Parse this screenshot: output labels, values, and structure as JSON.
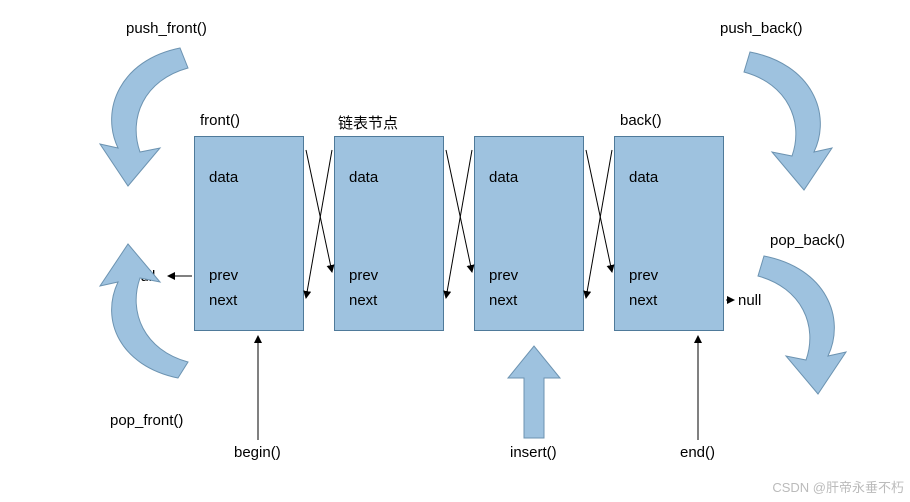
{
  "labels": {
    "push_front": "push_front()",
    "push_back": "push_back()",
    "pop_front": "pop_front()",
    "pop_back": "pop_back()",
    "front": "front()",
    "back": "back()",
    "node_header": "链表节点",
    "begin": "begin()",
    "end": "end()",
    "insert": "insert()",
    "null_left": "null",
    "null_right": "null"
  },
  "node_fields": {
    "data": "data",
    "prev": "prev",
    "next": "next"
  },
  "watermark": "CSDN @肝帝永垂不朽",
  "colors": {
    "node_fill": "#9ec2df",
    "node_stroke": "#4f7a9a",
    "arrow_fill": "#9ec2df",
    "arrow_stroke": "#6c93b1"
  }
}
